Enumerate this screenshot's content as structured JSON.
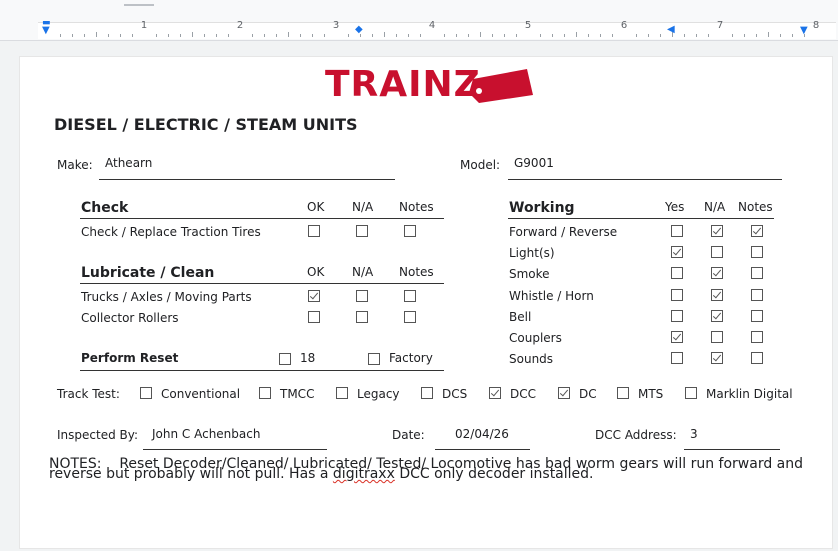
{
  "ruler": {
    "numbers": [
      "1",
      "2",
      "3",
      "4",
      "5",
      "6",
      "7",
      "8"
    ]
  },
  "logo": {
    "text": "TRAINZ"
  },
  "form": {
    "title": "DIESEL / ELECTRIC / STEAM UNITS",
    "make_label": "Make:",
    "make_value": "Athearn",
    "model_label": "Model:",
    "model_value": "G9001",
    "check": {
      "title": "Check",
      "cols": [
        "OK",
        "N/A",
        "Notes"
      ],
      "rows": [
        {
          "label": "Check / Replace Traction Tires",
          "values": [
            false,
            false,
            false
          ]
        }
      ]
    },
    "lubricate": {
      "title": "Lubricate / Clean",
      "cols": [
        "OK",
        "N/A",
        "Notes"
      ],
      "rows": [
        {
          "label": "Trucks / Axles / Moving Parts",
          "values": [
            true,
            false,
            false
          ]
        },
        {
          "label": "Collector Rollers",
          "values": [
            false,
            false,
            false
          ]
        }
      ]
    },
    "reset": {
      "title": "Perform Reset",
      "options": [
        {
          "label": "18",
          "checked": false
        },
        {
          "label": "Factory",
          "checked": false
        }
      ]
    },
    "working": {
      "title": "Working",
      "cols": [
        "Yes",
        "N/A",
        "Notes"
      ],
      "rows": [
        {
          "label": "Forward / Reverse",
          "values": [
            false,
            true,
            true
          ]
        },
        {
          "label": "Light(s)",
          "values": [
            true,
            false,
            false
          ]
        },
        {
          "label": "Smoke",
          "values": [
            false,
            true,
            false
          ]
        },
        {
          "label": "Whistle / Horn",
          "values": [
            false,
            true,
            false
          ]
        },
        {
          "label": "Bell",
          "values": [
            false,
            true,
            false
          ]
        },
        {
          "label": "Couplers",
          "values": [
            true,
            false,
            false
          ]
        },
        {
          "label": "Sounds",
          "values": [
            false,
            true,
            false
          ]
        }
      ]
    },
    "track_test": {
      "label": "Track Test:",
      "options": [
        {
          "label": "Conventional",
          "checked": false
        },
        {
          "label": "TMCC",
          "checked": false
        },
        {
          "label": "Legacy",
          "checked": false
        },
        {
          "label": "DCS",
          "checked": false
        },
        {
          "label": "DCC",
          "checked": true
        },
        {
          "label": "DC",
          "checked": true
        },
        {
          "label": "MTS",
          "checked": false
        },
        {
          "label": "Marklin Digital",
          "checked": false
        }
      ]
    },
    "inspected_by_label": "Inspected By:",
    "inspected_by_value": "John C Achenbach",
    "date_label": "Date:",
    "date_value": "02/04/26",
    "dcc_address_label": "DCC Address:",
    "dcc_address_value": "3",
    "notes": {
      "label": "NOTES:",
      "text_before": "Reset Decoder/Cleaned/ Lubricated/ Tested/ Locomotive has bad worm gears will run forward and reverse but probably will not pull.  Has a ",
      "misspelled": "digitraxx",
      "text_after": " DCC only decoder installed."
    }
  }
}
